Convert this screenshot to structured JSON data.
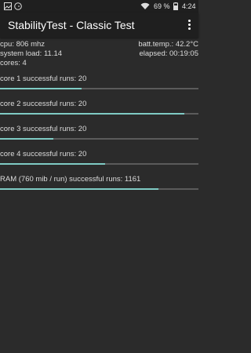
{
  "status_bar": {
    "battery_percent": "69 %",
    "time": "4:24",
    "icons": [
      "image-icon",
      "clock-icon",
      "wifi-icon",
      "battery-icon"
    ]
  },
  "appbar": {
    "title": "StabilityTest - Classic Test",
    "menu_icon": "overflow-menu-icon"
  },
  "stats": {
    "cpu": "cpu: 806 mhz",
    "batt_temp": "batt.temp.: 42.2°C",
    "system_load": "system load: 11.14",
    "elapsed": "elapsed: 00:19:05",
    "cores": "cores: 4"
  },
  "runs": [
    {
      "label": "core 1 successful runs: 20",
      "progress": 0.41
    },
    {
      "label": "core 2 successful runs: 20",
      "progress": 0.93
    },
    {
      "label": "core 3 successful runs: 20",
      "progress": 0.27
    },
    {
      "label": "core 4 successful runs: 20",
      "progress": 0.53
    },
    {
      "label": "RAM (760 mib / run) successful runs: 1161",
      "progress": 0.8
    }
  ],
  "colors": {
    "accent": "#7fcbc4",
    "track": "#5b5b5b",
    "background": "#2b2b2b",
    "appbar": "#1f1f1f"
  }
}
